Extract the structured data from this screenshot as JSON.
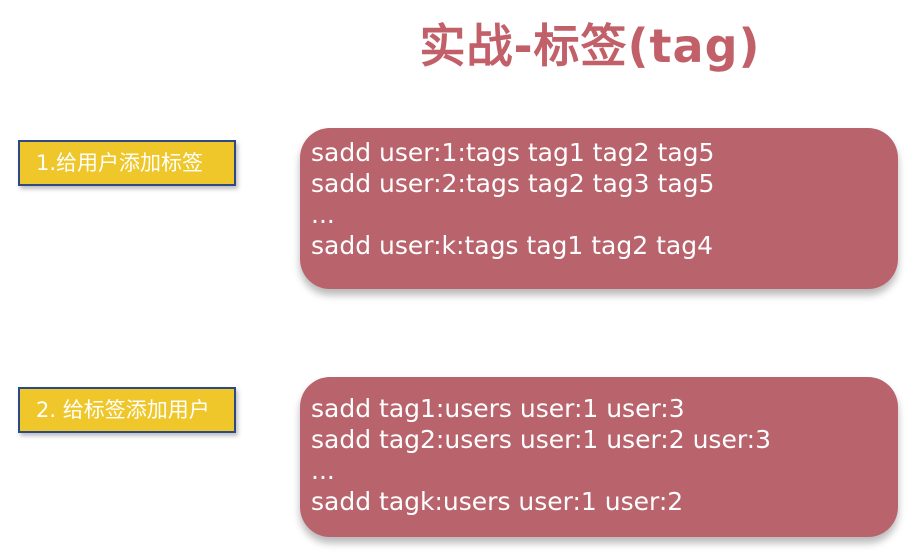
{
  "title": "实战-标签(tag)",
  "sections": [
    {
      "label": "1.给用户添加标签",
      "commands": [
        "sadd user:1:tags tag1 tag2 tag5",
        "sadd user:2:tags tag2 tag3 tag5",
        "...",
        "sadd user:k:tags tag1 tag2 tag4"
      ]
    },
    {
      "label": "2. 给标签添加用户",
      "commands": [
        "sadd tag1:users user:1 user:3",
        "sadd tag2:users user:1 user:2 user:3",
        "...",
        "sadd tagk:users user:1 user:2"
      ]
    }
  ],
  "colors": {
    "title": "#c2606a",
    "box": "#b9636d",
    "label_bg": "#efc72a",
    "label_border": "#2b4a86"
  }
}
